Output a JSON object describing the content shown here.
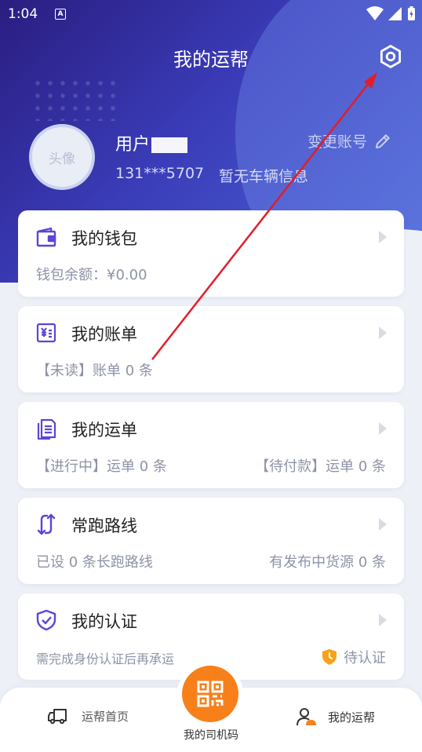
{
  "status_bar": {
    "time": "1:04",
    "notification_icon": "A"
  },
  "header": {
    "title": "我的运帮",
    "settings_icon": "gear-icon"
  },
  "profile": {
    "avatar_text": "头像",
    "username": "用户",
    "switch_account": "变更账号",
    "phone": "131***5707",
    "vehicle_info": "暂无车辆信息"
  },
  "cards": {
    "wallet": {
      "title": "我的钱包",
      "balance": "钱包余额：¥0.00"
    },
    "bill": {
      "title": "我的账单",
      "unread": "【未读】账单 0 条"
    },
    "waybill": {
      "title": "我的运单",
      "in_progress": "【进行中】运单 0 条",
      "unpaid": "【待付款】运单 0 条"
    },
    "routes": {
      "title": "常跑路线",
      "set_routes": "已设 0 条长跑路线",
      "available": "有发布中货源 0 条"
    },
    "cert": {
      "title": "我的认证",
      "hint": "需完成身份认证后再承运",
      "status": "待认证"
    }
  },
  "tabbar": {
    "home": "运帮首页",
    "qr": "我的司机码",
    "mine": "我的运帮"
  },
  "colors": {
    "accent": "#5b45d6",
    "orange": "#f7801a",
    "header_bg": "#3a3cb8",
    "annotation": "#e01e2a"
  }
}
